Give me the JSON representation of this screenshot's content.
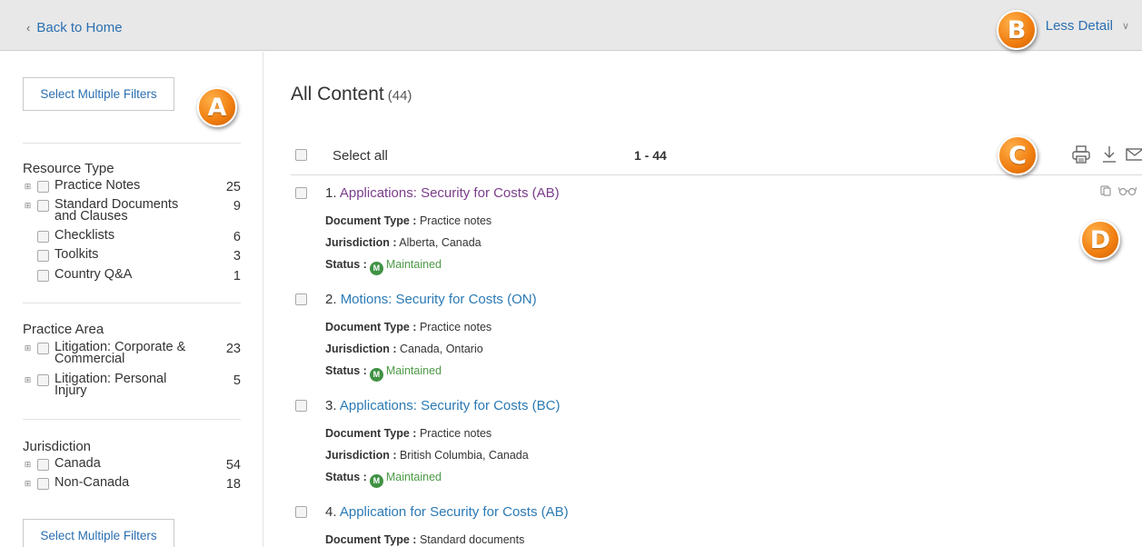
{
  "topbar": {
    "back_label": "Back to Home",
    "detail_label": "Less Detail"
  },
  "badges": {
    "a": "A",
    "b": "B",
    "c": "C",
    "d": "D"
  },
  "sidebar": {
    "select_filters_label": "Select Multiple Filters",
    "groups": [
      {
        "title": "Resource Type",
        "items": [
          {
            "label": "Practice Notes",
            "count": "25"
          },
          {
            "label": "Standard Documents and Clauses",
            "count": "9"
          },
          {
            "label": "Checklists",
            "count": "6"
          },
          {
            "label": "Toolkits",
            "count": "3"
          },
          {
            "label": "Country Q&A",
            "count": "1"
          }
        ]
      },
      {
        "title": "Practice Area",
        "items": [
          {
            "label": "Litigation: Corporate & Commercial",
            "count": "23"
          },
          {
            "label": "Litigation: Personal Injury",
            "count": "5"
          }
        ]
      },
      {
        "title": "Jurisdiction",
        "items": [
          {
            "label": "Canada",
            "count": "54"
          },
          {
            "label": "Non-Canada",
            "count": "18"
          }
        ]
      }
    ]
  },
  "main": {
    "title": "All Content",
    "count": "(44)",
    "select_all": "Select all",
    "range": "1 - 44",
    "meta_labels": {
      "doc_type": "Document Type :",
      "jurisdiction": "Jurisdiction :",
      "status": "Status :"
    },
    "results": [
      {
        "num": "1.",
        "title": "Applications: Security for Costs (AB)",
        "doc_type": "Practice notes",
        "jurisdiction": "Alberta, Canada",
        "status": "Maintained",
        "status_icon": "M",
        "title_color": "#7a3d8a"
      },
      {
        "num": "2.",
        "title": "Motions: Security for Costs (ON)",
        "doc_type": "Practice notes",
        "jurisdiction": "Canada, Ontario",
        "status": "Maintained",
        "status_icon": "M",
        "title_color": "#2b7ab5"
      },
      {
        "num": "3.",
        "title": "Applications: Security for Costs (BC)",
        "doc_type": "Practice notes",
        "jurisdiction": "British Columbia, Canada",
        "status": "Maintained",
        "status_icon": "M",
        "title_color": "#2b7ab5"
      },
      {
        "num": "4.",
        "title": "Application for Security for Costs (AB)",
        "doc_type": "Standard documents",
        "title_color": "#2b7ab5"
      }
    ]
  },
  "colors": {
    "link": "#2b6fb0",
    "visited": "#7a3d8a",
    "badge_orange": "#f07d10",
    "maintained": "#4c9a45"
  }
}
